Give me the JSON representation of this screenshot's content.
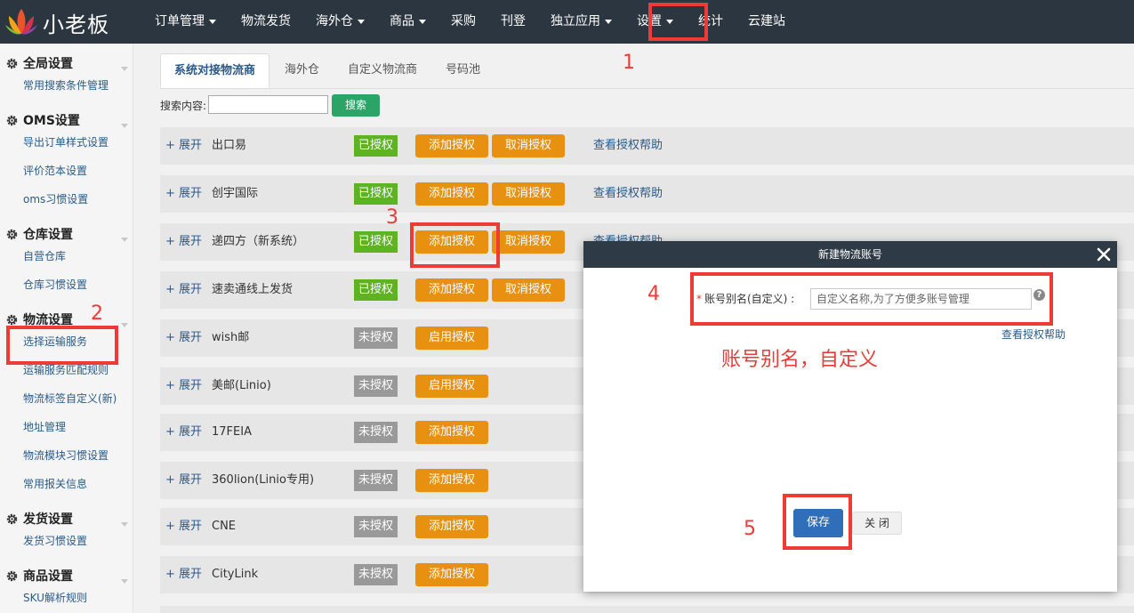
{
  "brand": {
    "name": "小老板"
  },
  "nav": [
    {
      "label": "订单管理",
      "caret": true
    },
    {
      "label": "物流发货",
      "caret": false
    },
    {
      "label": "海外仓",
      "caret": true
    },
    {
      "label": "商品",
      "caret": true
    },
    {
      "label": "采购",
      "caret": false
    },
    {
      "label": "刊登",
      "caret": false
    },
    {
      "label": "独立应用",
      "caret": true
    },
    {
      "label": "设置",
      "caret": true
    },
    {
      "label": "统计",
      "caret": false
    },
    {
      "label": "云建站",
      "caret": false
    }
  ],
  "sidebar": {
    "groups": [
      {
        "title": "全局设置",
        "items": [
          "常用搜索条件管理"
        ]
      },
      {
        "title": "OMS设置",
        "items": [
          "导出订单样式设置",
          "评价范本设置",
          "oms习惯设置"
        ]
      },
      {
        "title": "仓库设置",
        "items": [
          "自营仓库",
          "仓库习惯设置"
        ]
      },
      {
        "title": "物流设置",
        "items": [
          "选择运输服务",
          "运输服务匹配规则",
          "物流标签自定义(新)",
          "地址管理",
          "物流模块习惯设置",
          "常用报关信息"
        ]
      },
      {
        "title": "发货设置",
        "items": [
          "发货习惯设置"
        ]
      },
      {
        "title": "商品设置",
        "items": [
          "SKU解析规则"
        ]
      }
    ]
  },
  "tabs": [
    "系统对接物流商",
    "海外仓",
    "自定义物流商",
    "号码池"
  ],
  "search": {
    "label": "搜索内容:",
    "value": "",
    "button": "搜索"
  },
  "expand_label": "+ 展开",
  "help_label": "查看授权帮助",
  "carriers": [
    {
      "name": "出口易",
      "status": "已授权",
      "authorized": true,
      "add": "添加授权",
      "cancel": "取消授权",
      "help": true
    },
    {
      "name": "创宇国际",
      "status": "已授权",
      "authorized": true,
      "add": "添加授权",
      "cancel": "取消授权",
      "help": true
    },
    {
      "name": "递四方（新系统）",
      "status": "已授权",
      "authorized": true,
      "add": "添加授权",
      "cancel": "取消授权",
      "help": true
    },
    {
      "name": "速卖通线上发货",
      "status": "已授权",
      "authorized": true,
      "add": "添加授权",
      "cancel": "取消授权",
      "help": false
    },
    {
      "name": "wish邮",
      "status": "未授权",
      "authorized": false,
      "add": "启用授权",
      "cancel": "",
      "help": false
    },
    {
      "name": "美邮(Linio)",
      "status": "未授权",
      "authorized": false,
      "add": "启用授权",
      "cancel": "",
      "help": false
    },
    {
      "name": "17FEIA",
      "status": "未授权",
      "authorized": false,
      "add": "添加授权",
      "cancel": "",
      "help": false
    },
    {
      "name": "360lion(Linio专用)",
      "status": "未授权",
      "authorized": false,
      "add": "添加授权",
      "cancel": "",
      "help": false
    },
    {
      "name": "CNE",
      "status": "未授权",
      "authorized": false,
      "add": "添加授权",
      "cancel": "",
      "help": false
    },
    {
      "name": "CityLink",
      "status": "未授权",
      "authorized": false,
      "add": "添加授权",
      "cancel": "",
      "help": false
    }
  ],
  "annotations": {
    "n1": "1",
    "n2": "2",
    "n3": "3",
    "n4": "4",
    "n5": "5",
    "note": "账号别名，自定义"
  },
  "modal": {
    "title": "新建物流账号",
    "field_label": "账号别名(自定义) :",
    "required_mark": "*",
    "placeholder": "自定义名称,为了方便多账号管理",
    "help_icon": "?",
    "help_link": "查看授权帮助",
    "save": "保存",
    "close": "关 闭"
  },
  "colors": {
    "topbar": "#2c3640",
    "authorized": "#5eb321",
    "unauthorized": "#999999",
    "action": "#e8900f",
    "annotation": "#ef3b36",
    "primary": "#2f6eb8"
  }
}
